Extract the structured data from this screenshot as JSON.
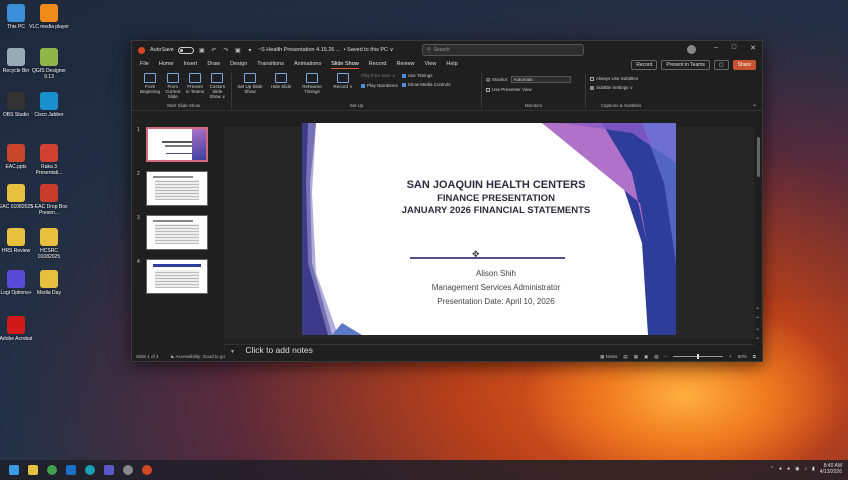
{
  "desktop": {
    "icons": [
      {
        "label": "This PC",
        "color": "#3a8fd8"
      },
      {
        "label": "VLC media player",
        "color": "#f08a1a"
      },
      {
        "label": "Recycle Bin",
        "color": "#9aa9b8"
      },
      {
        "label": "QGIS Designer 9.13",
        "color": "#8fb44a"
      },
      {
        "label": "OBS Studio",
        "color": "#333333"
      },
      {
        "label": "Cisco Jabber",
        "color": "#1a8fd0"
      },
      {
        "label": "EAC.pptx",
        "color": "#c8452a"
      },
      {
        "label": "Raka 3 Presentati...",
        "color": "#d04030"
      },
      {
        "label": "EAC 01082025",
        "color": "#e8c040"
      },
      {
        "label": "5-EAC Drop Box Presen...",
        "color": "#c83a2a"
      },
      {
        "label": "HRS Review",
        "color": "#e8c040"
      },
      {
        "label": "HCSRC 01082025",
        "color": "#e8c040"
      },
      {
        "label": "Logi Options+",
        "color": "#5a4ad8"
      },
      {
        "label": "Media Day",
        "color": "#e8c040"
      },
      {
        "label": "Adobe Acrobat",
        "color": "#d01a1a"
      }
    ]
  },
  "window": {
    "autosave_label": "AutoSave",
    "file_title": "~S Health Presentation 4.15.26 ...",
    "saved_status": "• Saved to this PC ∨",
    "search_placeholder": "Search",
    "controls": {
      "minimize": "–",
      "maximize": "□",
      "close": "✕"
    }
  },
  "menu": {
    "tabs": [
      "File",
      "Home",
      "Insert",
      "Draw",
      "Design",
      "Transitions",
      "Animations",
      "Slide Show",
      "Record",
      "Review",
      "View",
      "Help"
    ],
    "active_tab": "Slide Show",
    "record_label": "Record",
    "present_teams_label": "Present in Teams",
    "share_label": "Share"
  },
  "ribbon": {
    "start_group": {
      "buttons": [
        "From Beginning",
        "From Current Slide",
        "Present in Teams",
        "Custom Slide Show ∨"
      ],
      "name": "Start Slide Show"
    },
    "setup_group": {
      "buttons": [
        "Set Up Slide Show",
        "Hide Slide",
        "Rehearse Timings",
        "Record ∨"
      ],
      "checks": [
        {
          "label": "Use Timings",
          "checked": true
        },
        {
          "label": "Play Narrations",
          "checked": true
        },
        {
          "label": "Show Media Controls",
          "checked": true
        },
        {
          "label": "Use Presenter View",
          "checked": false
        }
      ],
      "play_from_label": "Play from Start ∨",
      "name": "Set Up"
    },
    "monitors_group": {
      "monitor_label": "Monitor:",
      "monitor_value": "Automatic",
      "presenter_view_label": "Use Presenter View",
      "name": "Monitors"
    },
    "captions_group": {
      "always_subtitles": "Always Use Subtitles",
      "subtitle_settings": "Subtitle Settings ∨",
      "name": "Captions & Subtitles"
    }
  },
  "thumbnails": [
    {
      "num": "1"
    },
    {
      "num": "2"
    },
    {
      "num": "3"
    },
    {
      "num": "4"
    }
  ],
  "slide": {
    "line1": "SAN JOAQUIN HEALTH CENTERS",
    "line2": "FINANCE PRESENTATION",
    "line3": "JANUARY 2026 FINANCIAL STATEMENTS",
    "presenter": "Alison Shih",
    "role": "Management Services Administrator",
    "date": "Presentation Date: April 10, 2026"
  },
  "notes": {
    "placeholder": "Click to add notes"
  },
  "status": {
    "slide_counter": "Slide 1 of 4",
    "accessibility": "Accessibility: Good to go",
    "notes_label": "Notes",
    "zoom": "60%"
  },
  "taskbar": {
    "time": "8:40 AM",
    "date": "4/13/2026"
  },
  "colors": {
    "accent": "#c8532e",
    "slide_purple": "#4b3f9a",
    "slide_title": "#2d2d3a"
  }
}
